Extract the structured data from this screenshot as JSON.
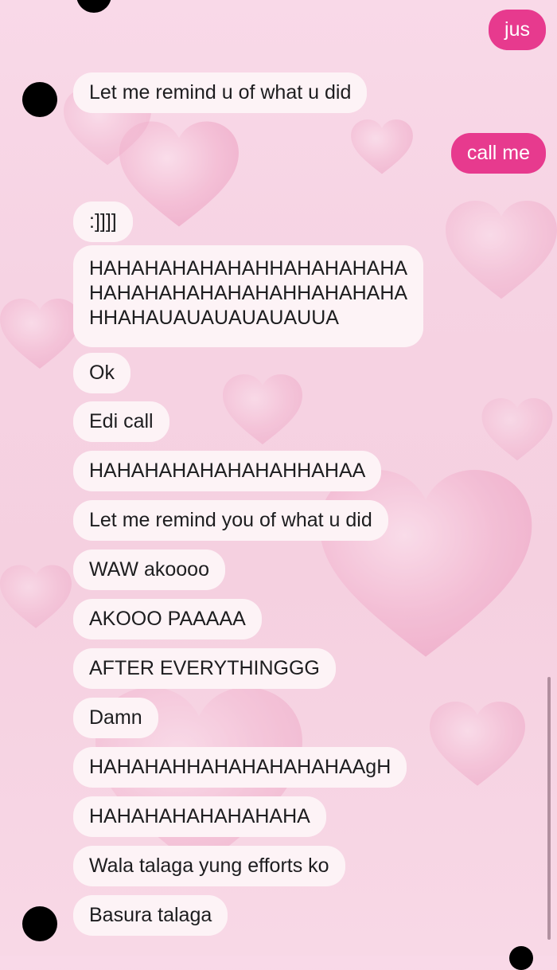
{
  "colors": {
    "incoming_bubble": "#fdf3f6",
    "outgoing_bubble": "#e73a8e",
    "incoming_text": "#1d1d1f",
    "outgoing_text": "#ffffff",
    "background": "#f6d3e3"
  },
  "messages": {
    "m1": "jus",
    "m2": "Let me remind u of what u did",
    "m3": "call me",
    "m4": ":]]]]",
    "m5_line1": "HAHAHAHAHAHAHHAHAHAHAHA",
    "m5_line2": "HAHAHAHAHAHAHAHHAHAHAHA",
    "m5_line3": "HHAHAUAUAUAUAUAUUA",
    "m6": "Ok",
    "m7": "Edi call",
    "m8": "HAHAHAHAHAHAHAHHAHAA",
    "m9": "Let me remind you of what u did",
    "m10": "WAW akoooo",
    "m11": "AKOOO PAAAAA",
    "m12": "AFTER EVERYTHINGGG",
    "m13": "Damn",
    "m14": "HAHAHAHHAHAHAHAHAHAAgH",
    "m15": "HAHAHAHAHAHAHAHA",
    "m16": "Wala talaga yung efforts ko",
    "m17": "Basura talaga"
  }
}
